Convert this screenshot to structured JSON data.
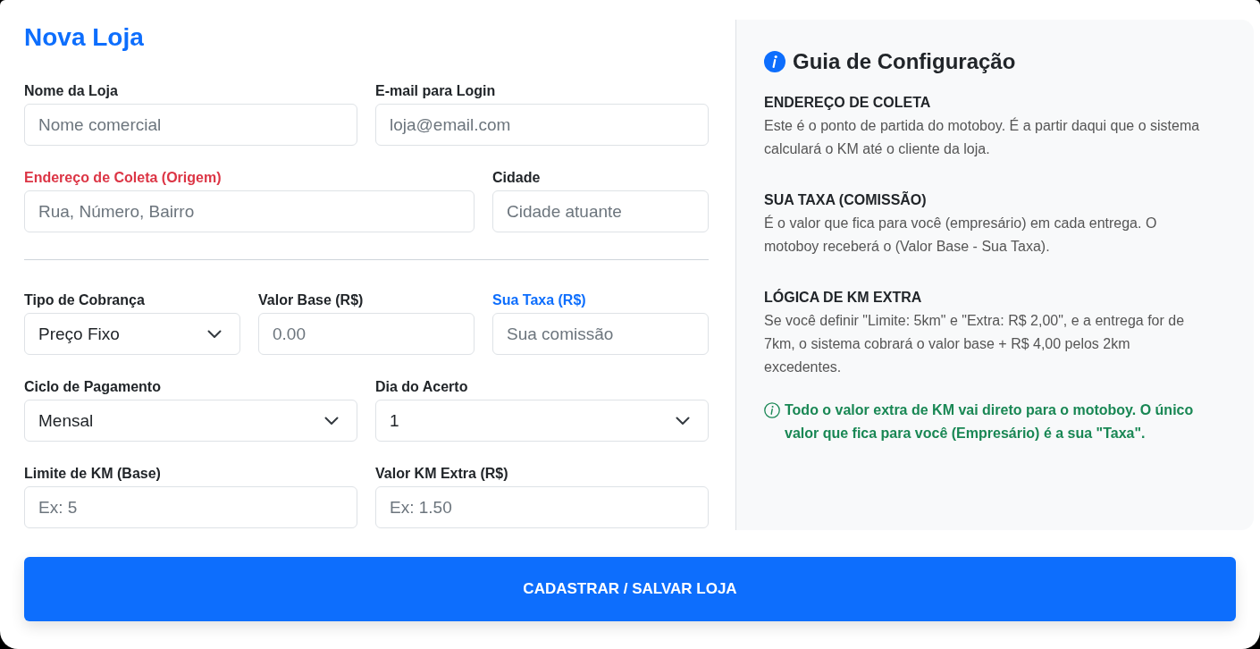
{
  "form": {
    "title": "Nova Loja",
    "sections": [
      {
        "rows": [
          {
            "fields": [
              {
                "kind": "input",
                "label": "Nome da Loja",
                "placeholder": "Nome comercial"
              },
              {
                "kind": "input",
                "label": "E-mail para Login",
                "placeholder": "loja@email.com"
              }
            ]
          },
          {
            "fields": [
              {
                "kind": "input",
                "label": "Endereço de Coleta (Origem)",
                "color": "#dc3545",
                "placeholder": "Rua, Número, Bairro"
              },
              {
                "kind": "input",
                "label": "Cidade",
                "placeholder": "Cidade atuante"
              }
            ]
          }
        ]
      },
      {
        "rows": [
          {
            "fields": [
              {
                "kind": "select",
                "label": "Tipo de Cobrança",
                "value": "Preço Fixo"
              },
              {
                "kind": "input",
                "label": "Valor Base (R$)",
                "placeholder": "0.00"
              },
              {
                "kind": "input",
                "label": "Sua Taxa (R$)",
                "color": "#0d6efd",
                "placeholder": "Sua comissão"
              }
            ]
          },
          {
            "fields": [
              {
                "kind": "select",
                "label": "Ciclo de Pagamento",
                "value": "Mensal"
              },
              {
                "kind": "select",
                "label": "Dia do Acerto",
                "value": "1"
              }
            ]
          },
          {
            "fields": [
              {
                "kind": "input",
                "label": "Limite de KM (Base)",
                "placeholder": "Ex: 5"
              },
              {
                "kind": "input",
                "label": "Valor KM Extra (R$)",
                "placeholder": "Ex: 1.50"
              }
            ]
          }
        ]
      }
    ]
  },
  "guide": {
    "title": "Guia de Configuração",
    "sections": [
      {
        "heading": "ENDEREÇO DE COLETA",
        "text": "Este é o ponto de partida do motoboy. É a partir daqui que o sistema calculará o KM até o cliente da loja."
      },
      {
        "heading": "SUA TAXA (COMISSÃO)",
        "text": "É o valor que fica para você (empresário) em cada entrega. O motoboy receberá o (Valor Base - Sua Taxa)."
      },
      {
        "heading": "LÓGICA DE KM EXTRA",
        "text": "Se você definir \"Limite: 5km\" e \"Extra: R$ 2,00\", e a entrega for de 7km, o sistema cobrará o valor base + R$ 4,00 pelos 2km excedentes."
      }
    ],
    "note": "Todo o valor extra de KM vai direto para o motoboy. O único valor que fica para você (Empresário) é a sua \"Taxa\"."
  },
  "submit_button": {
    "label": "CADASTRAR / SALVAR LOJA"
  }
}
